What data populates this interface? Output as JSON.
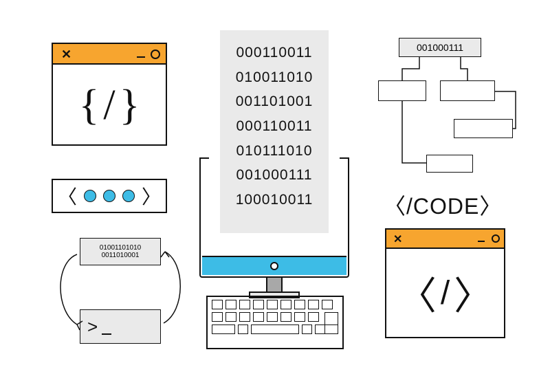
{
  "window1": {
    "glyph_left": "{",
    "glyph_mid": "/",
    "glyph_right": "}"
  },
  "loading": {
    "left_chev": "〈",
    "right_chev": "〉"
  },
  "cycle": {
    "data_box": "01001101010\n0011010001",
    "prompt": ">_"
  },
  "binary_lines": [
    "000110011",
    "010011010",
    "001101001",
    "000110011",
    "010111010",
    "001000111",
    "100010011"
  ],
  "flow": {
    "top_label": "001000111"
  },
  "codetag": {
    "open": "〈",
    "slash": "/",
    "word": "CODE",
    "close": "〉"
  },
  "window2": {
    "left": "〈",
    "slash": "/",
    "right": "〉"
  },
  "colors": {
    "accent_orange": "#f7a52f",
    "accent_blue": "#3dbce6",
    "grey": "#eaeaea"
  }
}
